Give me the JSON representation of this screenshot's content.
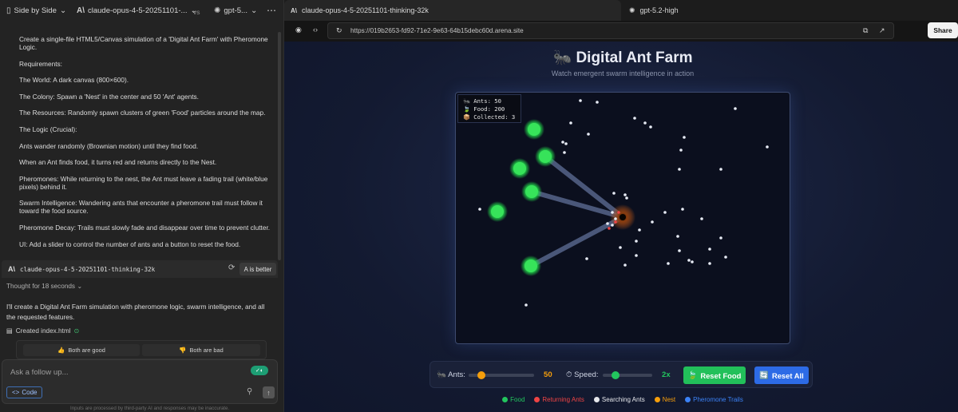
{
  "left_pane": {
    "topbar": {
      "mode": "Side by Side",
      "model_a": "claude-opus-4-5-20251101-...",
      "vs": "vs",
      "model_b": "gpt-5...",
      "more": "⋯"
    },
    "prompt_paragraphs": [
      "Create a single-file HTML5/Canvas simulation of a 'Digital Ant Farm' with Pheromone Logic.",
      "Requirements:",
      "The World: A dark canvas (800×600).",
      "The Colony: Spawn a 'Nest' in the center and 50 'Ant' agents.",
      "The Resources: Randomly spawn clusters of green 'Food' particles around the map.",
      "The Logic (Crucial):",
      "Ants wander randomly (Brownian motion) until they find food.",
      "When an Ant finds food, it turns red and returns directly to the Nest.",
      "Pheromones: While returning to the nest, the Ant must leave a fading trail (white/blue pixels) behind it.",
      "Swarm Intelligence: Wandering ants that encounter a pheromone trail must follow it toward the food source.",
      "Pheromone Decay: Trails must slowly fade and disappear over time to prevent clutter.",
      "UI: Add a slider to control the number of ants and a button to reset the food."
    ],
    "model_bar": {
      "logo": "A\\",
      "model": "claude-opus-4-5-20251101-thinking-32k",
      "better_label": "A is better"
    },
    "thought": "Thought for 18 seconds",
    "response": "I'll create a Digital Ant Farm simulation with pheromone logic, swarm intelligence, and all the requested features.",
    "created_file": "Created index.html",
    "vote_good": "Both are good",
    "vote_bad": "Both are bad",
    "composer": {
      "placeholder": "Ask a follow up...",
      "code_label": "Code"
    },
    "footnote": "Inputs are processed by third-party AI and responses may be inaccurate."
  },
  "right_pane": {
    "tabs": [
      {
        "label": "claude-opus-4-5-20251101-thinking-32k",
        "active": true
      },
      {
        "label": "gpt-5.2-high",
        "active": false
      }
    ],
    "url": "https://019b2653-fd92-71e2-9e63-64b15debc60d.arena.site",
    "share_label": "Share",
    "page": {
      "title": "Digital Ant Farm",
      "title_emoji": "🐜",
      "subtitle": "Watch emergent swarm intelligence in action",
      "stats": {
        "ants": "Ants: 50",
        "food": "Food: 200",
        "collected": "Collected: 3"
      },
      "controls": {
        "ants_label": "Ants:",
        "ants_value": "50",
        "ants_fraction": 0.2,
        "speed_label": "Speed:",
        "speed_value": "2x",
        "speed_fraction": 0.25,
        "reset_food": "Reset Food",
        "reset_all": "Reset All"
      },
      "legend": [
        {
          "label": "Food",
          "color": "#22c55e"
        },
        {
          "label": "Returning Ants",
          "color": "#ef4444"
        },
        {
          "label": "Searching Ants",
          "color": "#e5e7eb"
        },
        {
          "label": "Nest",
          "color": "#f59e0b"
        },
        {
          "label": "Pheromone Trails",
          "color": "#3b82f6"
        }
      ]
    }
  }
}
